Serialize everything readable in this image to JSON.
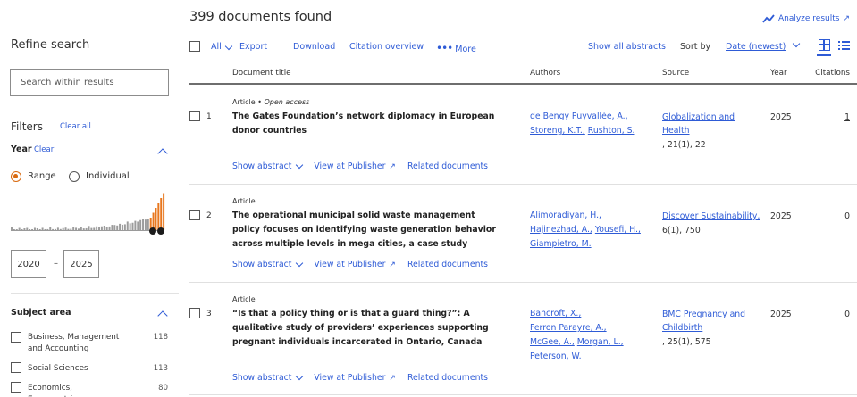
{
  "header": {
    "results_count": "399 documents found",
    "analyze_label": "Analyze results",
    "analyze_arrow": "↗"
  },
  "toolbar": {
    "all_label": "All",
    "export_label": "Export",
    "download_label": "Download",
    "citation_overview_label": "Citation overview",
    "more_dots": "•••",
    "more_label": "More",
    "show_all_abstracts_label": "Show all abstracts",
    "sort_by_label": "Sort by",
    "sort_value": "Date (newest)"
  },
  "sidebar": {
    "refine_title": "Refine search",
    "search_placeholder": "Search within results",
    "filters_title": "Filters",
    "clear_all_label": "Clear all",
    "year": {
      "title": "Year",
      "clear_label": "Clear",
      "range_label": "Range",
      "individual_label": "Individual",
      "from": "2020",
      "to": "2025",
      "dash": "–",
      "selected_color": "#e8771e"
    },
    "subject_area": {
      "title": "Subject area",
      "items": [
        {
          "label": "Business, Management and Accounting",
          "count": "118"
        },
        {
          "label": "Social Sciences",
          "count": "113"
        },
        {
          "label": "Economics, Econometrics",
          "count": "80"
        }
      ]
    }
  },
  "columns": {
    "title": "Document title",
    "authors": "Authors",
    "source": "Source",
    "year": "Year",
    "citations": "Citations"
  },
  "documents": [
    {
      "num": "1",
      "type": "Article",
      "type_sep": "•",
      "access": "Open access",
      "title": "The Gates Foundation’s network diplomacy in European donor countries",
      "authors": [
        "de Bengy Puyvallée, A.,",
        "Storeng, K.T.,",
        "Rushton, S."
      ],
      "source_name": "Globalization and Health",
      "source_vol": ", 21(1), 22",
      "year": "2025",
      "citations": "1"
    },
    {
      "num": "2",
      "type": "Article",
      "access": "",
      "title": "The operational municipal solid waste management policy focuses on identifying waste generation behavior across multiple levels in mega cities, a case study",
      "authors": [
        "Alimoradiyan, H.,",
        "Hajinezhad, A.,",
        "Yousefi, H.,",
        "Giampietro, M."
      ],
      "source_name": "Discover Sustainability,",
      "source_vol": "6(1), 750",
      "year": "2025",
      "citations": "0"
    },
    {
      "num": "3",
      "type": "Article",
      "access": "",
      "title": "“Is that a policy thing or is that a guard thing?”: A qualitative study of providers’ experiences supporting pregnant individuals incarcerated in Ontario, Canada",
      "authors": [
        "Bancroft, X.,",
        "Ferron Parayre, A.,",
        "McGee, A.,",
        "Morgan, L.,",
        "Peterson, W."
      ],
      "source_name": "BMC Pregnancy and Childbirth",
      "source_vol": ", 25(1), 575",
      "year": "2025",
      "citations": "0"
    }
  ],
  "row_actions": {
    "show_abstract": "Show abstract",
    "view_publisher": "View at Publisher",
    "related": "Related documents",
    "ext_arrow": "↗"
  },
  "icons": {
    "analyze": "trend-line-icon",
    "grid_view": "grid-view-icon",
    "list_view": "list-view-icon"
  },
  "colors": {
    "link": "#2e5bd6",
    "accent_orange": "#e8771e",
    "text": "#2e2e2e"
  }
}
